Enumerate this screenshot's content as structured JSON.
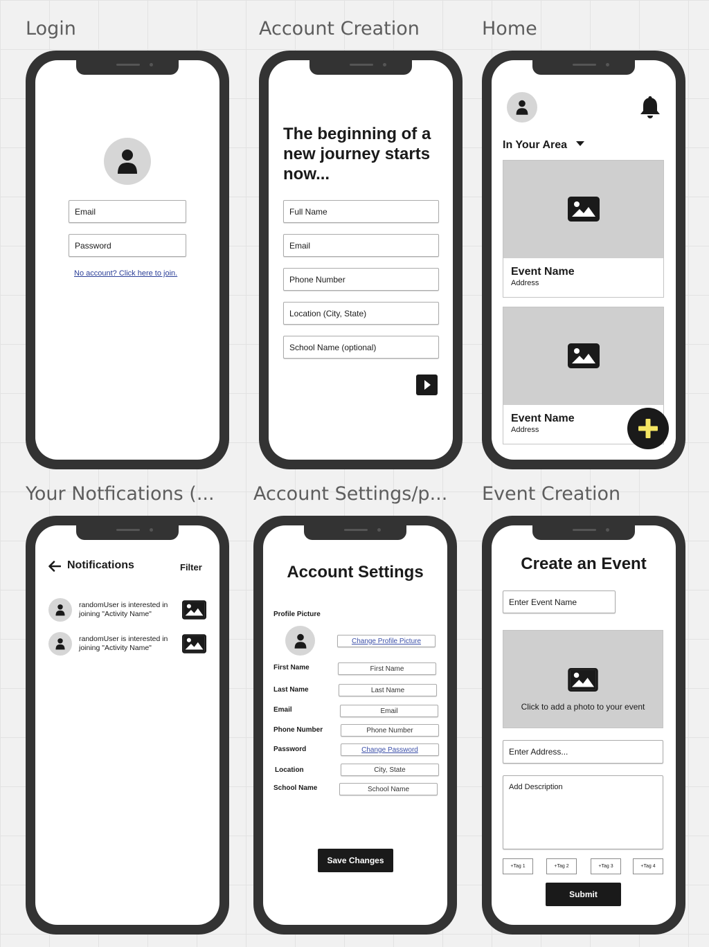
{
  "frames": {
    "login": "Login",
    "account_creation": "Account Creation",
    "home": "Home",
    "notifications": "Your Notfications (...",
    "account_settings": "Account Settings/p...",
    "event_creation": "Event Creation"
  },
  "login": {
    "email_placeholder": "Email",
    "password_placeholder": "Password",
    "join_link": "No account? Click here to join."
  },
  "account_creation": {
    "heading": "The beginning of a new journey starts now...",
    "fields": [
      "Full Name",
      "Email",
      "Phone Number",
      "Location (City, State)",
      "School Name (optional)"
    ]
  },
  "home": {
    "filter_label": "In Your Area",
    "events": [
      {
        "name": "Event Name",
        "address": "Address"
      },
      {
        "name": "Event Name",
        "address": "Address"
      }
    ],
    "fab_label": "+",
    "accent": "#f5e663"
  },
  "notifications": {
    "title": "Notifications",
    "filter_label": "Filter",
    "items": [
      {
        "text": "randomUser is interested in joining \"Activity Name\""
      },
      {
        "text": "randomUser is interested in joining \"Activity Name\""
      }
    ]
  },
  "account_settings": {
    "title": "Account Settings",
    "profile_picture_label": "Profile Picture",
    "change_picture_link": "Change Profile Picture",
    "rows": [
      {
        "label": "First Name",
        "value": "First Name"
      },
      {
        "label": "Last Name",
        "value": "Last Name"
      },
      {
        "label": "Email",
        "value": "Email"
      },
      {
        "label": "Phone Number",
        "value": "Phone Number"
      },
      {
        "label": "Password",
        "value": "Change Password"
      },
      {
        "label": "Location",
        "value": "City, State"
      },
      {
        "label": "School Name",
        "value": "School Name"
      }
    ],
    "save_button": "Save Changes"
  },
  "event_creation": {
    "title": "Create an Event",
    "name_placeholder": "Enter Event Name",
    "photo_prompt": "Click to add a photo to your event",
    "address_placeholder": "Enter Address...",
    "description_placeholder": "Add Description",
    "tags": [
      "+Tag 1",
      "+Tag 2",
      "+Tag 3",
      "+Tag 4"
    ],
    "submit_button": "Submit"
  }
}
